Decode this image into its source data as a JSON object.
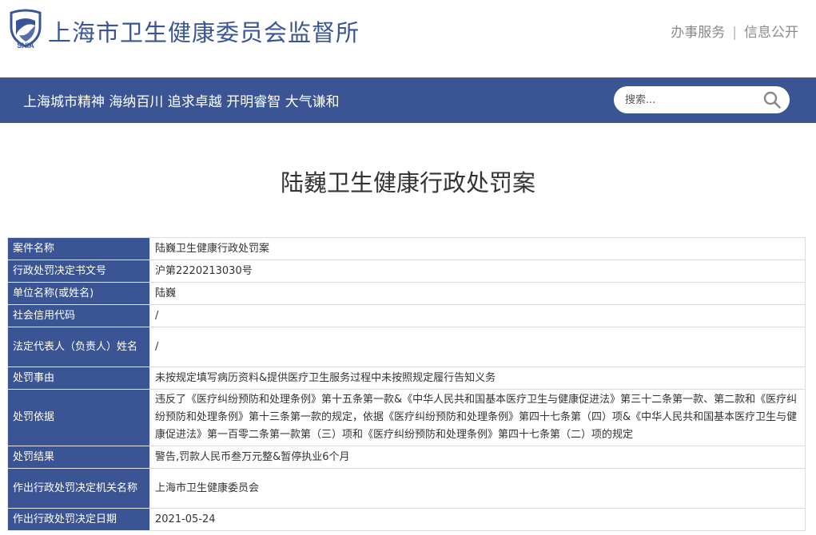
{
  "header": {
    "logo_text": "SHIA",
    "site_title": "上海市卫生健康委员会监督所",
    "links": [
      {
        "label": "办事服务"
      },
      {
        "label": "信息公开"
      }
    ]
  },
  "banner": {
    "slogan": "上海城市精神 海纳百川 追求卓越 开明睿智 大气谦和",
    "search_placeholder": "搜索..."
  },
  "page_title": "陆巍卫生健康行政处罚案",
  "rows": [
    {
      "label": "案件名称",
      "value": "陆巍卫生健康行政处罚案"
    },
    {
      "label": "行政处罚决定书文号",
      "value": "沪第2220213030号"
    },
    {
      "label": "单位名称(或姓名)",
      "value": "陆巍"
    },
    {
      "label": "社会信用代码",
      "value": "/"
    },
    {
      "label": "法定代表人（负责人）姓名",
      "value": "/"
    },
    {
      "label": "处罚事由",
      "value": "未按规定填写病历资料&提供医疗卫生服务过程中未按照规定履行告知义务"
    },
    {
      "label": "处罚依据",
      "value": "违反了《医疗纠纷预防和处理条例》第十五条第一款&《中华人民共和国基本医疗卫生与健康促进法》第三十二条第一款、第二款和《医疗纠纷预防和处理条例》第十三条第一款的规定，依据《医疗纠纷预防和处理条例》第四十七条第（四）项&《中华人民共和国基本医疗卫生与健康促进法》第一百零二条第一款第（三）项和《医疗纠纷预防和处理条例》第四十七条第（二）项的规定"
    },
    {
      "label": "处罚结果",
      "value": "警告,罚款人民币叁万元整&暂停执业6个月"
    },
    {
      "label": "作出行政处罚决定机关名称",
      "value": "上海市卫生健康委员会"
    },
    {
      "label": "作出行政处罚决定日期",
      "value": "2021-05-24"
    }
  ],
  "colors": {
    "brand_blue": "#3b5594",
    "title_blue": "#3a5596"
  }
}
